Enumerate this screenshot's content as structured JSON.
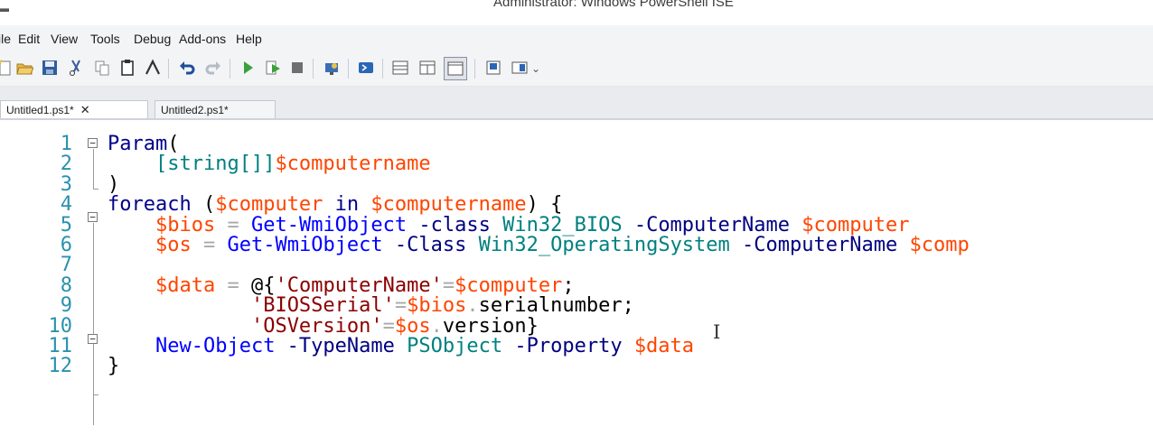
{
  "window": {
    "title": "Administrator: Windows PowerShell ISE"
  },
  "menu": [
    "ile",
    "Edit",
    "View",
    "Tools",
    "Debug",
    "Add-ons",
    "Help"
  ],
  "toolbar": {
    "icons": [
      "new-script-icon",
      "open-icon",
      "save-icon",
      "cut-icon",
      "copy-icon",
      "paste-icon",
      "clear-console-icon",
      "undo-icon",
      "redo-icon",
      "run-script-icon",
      "run-selection-icon",
      "stop-icon",
      "new-remote-tab-icon",
      "start-powershell-icon",
      "show-script-pane-top-icon",
      "show-script-pane-right-icon",
      "show-script-pane-maximized-icon",
      "show-command-window-icon",
      "show-command-addon-icon"
    ],
    "overflow": "⌄"
  },
  "tabs": [
    {
      "label": "Untitled1.ps1*",
      "close": "✕",
      "active": true
    },
    {
      "label": "Untitled2.ps1*",
      "active": false
    }
  ],
  "colors": {
    "keyword": "#00008b",
    "variable": "#ff4500",
    "type": "#008080",
    "command": "#0000ff",
    "parameter": "#000080",
    "string": "#8b0000",
    "member": "#000000",
    "operator": "#a9a9a9",
    "line_number": "#2b91af",
    "punct": "#000000"
  },
  "editor": {
    "lines": [
      {
        "n": "1",
        "tokens": [
          [
            "Param",
            "keyword"
          ],
          [
            "(",
            "punct"
          ]
        ]
      },
      {
        "n": "2",
        "tokens": [
          [
            "    ",
            "punct"
          ],
          [
            "[string[]]",
            "type"
          ],
          [
            "$computername",
            "variable"
          ]
        ]
      },
      {
        "n": "3",
        "tokens": [
          [
            ")",
            "punct"
          ]
        ]
      },
      {
        "n": "4",
        "tokens": [
          [
            "foreach",
            "keyword"
          ],
          [
            " (",
            "punct"
          ],
          [
            "$computer",
            "variable"
          ],
          [
            " in ",
            "keyword"
          ],
          [
            "$computername",
            "variable"
          ],
          [
            ") {",
            "punct"
          ]
        ]
      },
      {
        "n": "5",
        "tokens": [
          [
            "    ",
            "punct"
          ],
          [
            "$bios",
            "variable"
          ],
          [
            " = ",
            "operator"
          ],
          [
            "Get-WmiObject",
            "command"
          ],
          [
            " -class ",
            "parameter"
          ],
          [
            "Win32_BIOS",
            "type"
          ],
          [
            " -ComputerName ",
            "parameter"
          ],
          [
            "$computer",
            "variable"
          ]
        ]
      },
      {
        "n": "6",
        "tokens": [
          [
            "    ",
            "punct"
          ],
          [
            "$os",
            "variable"
          ],
          [
            " = ",
            "operator"
          ],
          [
            "Get-WmiObject",
            "command"
          ],
          [
            " -Class ",
            "parameter"
          ],
          [
            "Win32_OperatingSystem",
            "type"
          ],
          [
            " -ComputerName ",
            "parameter"
          ],
          [
            "$comp",
            "variable"
          ]
        ]
      },
      {
        "n": "7",
        "tokens": []
      },
      {
        "n": "8",
        "tokens": [
          [
            "    ",
            "punct"
          ],
          [
            "$data",
            "variable"
          ],
          [
            " = ",
            "operator"
          ],
          [
            "@{",
            "punct"
          ],
          [
            "'ComputerName'",
            "string"
          ],
          [
            "=",
            "operator"
          ],
          [
            "$computer",
            "variable"
          ],
          [
            ";",
            "punct"
          ]
        ]
      },
      {
        "n": "9",
        "tokens": [
          [
            "            ",
            "punct"
          ],
          [
            "'BIOSSerial'",
            "string"
          ],
          [
            "=",
            "operator"
          ],
          [
            "$bios",
            "variable"
          ],
          [
            ".",
            "operator"
          ],
          [
            "serialnumber",
            "member"
          ],
          [
            ";",
            "punct"
          ]
        ]
      },
      {
        "n": "10",
        "tokens": [
          [
            "            ",
            "punct"
          ],
          [
            "'OSVersion'",
            "string"
          ],
          [
            "=",
            "operator"
          ],
          [
            "$os",
            "variable"
          ],
          [
            ".",
            "operator"
          ],
          [
            "version",
            "member"
          ],
          [
            "}",
            "punct"
          ]
        ]
      },
      {
        "n": "11",
        "tokens": [
          [
            "    ",
            "punct"
          ],
          [
            "New-Object",
            "command"
          ],
          [
            " -TypeName ",
            "parameter"
          ],
          [
            "PSObject",
            "type"
          ],
          [
            " -Property ",
            "parameter"
          ],
          [
            "$data",
            "variable"
          ]
        ]
      },
      {
        "n": "12",
        "tokens": [
          [
            "}",
            "punct"
          ]
        ]
      }
    ],
    "text_cursor": "I"
  }
}
